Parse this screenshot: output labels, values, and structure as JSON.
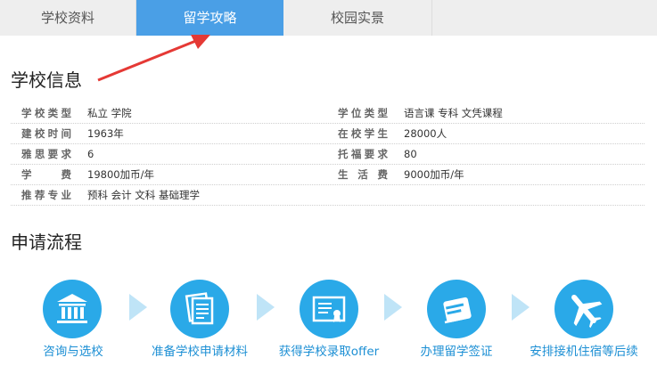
{
  "tabs": [
    {
      "label": "学校资料",
      "active": false
    },
    {
      "label": "留学攻略",
      "active": true
    },
    {
      "label": "校园实景",
      "active": false
    }
  ],
  "colors": {
    "active_tab": "#4a9fe6",
    "step_circle": "#2aa9e8",
    "step_text": "#1c8fd4",
    "annotation_arrow": "#e53935"
  },
  "school_info": {
    "title": "学校信息",
    "rows": [
      {
        "label1": "学校类型",
        "value1": "私立 学院",
        "label2": "学位类型",
        "value2": "语言课 专科 文凭课程"
      },
      {
        "label1": "建校时间",
        "value1": "1963年",
        "label2": "在校学生",
        "value2": "28000人"
      },
      {
        "label1": "雅思要求",
        "value1": "6",
        "label2": "托福要求",
        "value2": "80"
      },
      {
        "label1": "学 费",
        "value1": "19800加币/年",
        "label2": "生 活 费",
        "value2": "9000加币/年"
      },
      {
        "label1": "推荐专业",
        "value1": "预科 会计 文科 基础理学",
        "label2": "",
        "value2": ""
      }
    ]
  },
  "application_process": {
    "title": "申请流程",
    "steps": [
      {
        "label": "咨询与选校",
        "icon": "university-icon"
      },
      {
        "label": "准备学校申请材料",
        "icon": "documents-icon"
      },
      {
        "label": "获得学校录取offer",
        "icon": "certificate-icon"
      },
      {
        "label": "办理留学签证",
        "icon": "passport-icon"
      },
      {
        "label": "安排接机住宿等后续",
        "icon": "airplane-icon"
      }
    ]
  }
}
